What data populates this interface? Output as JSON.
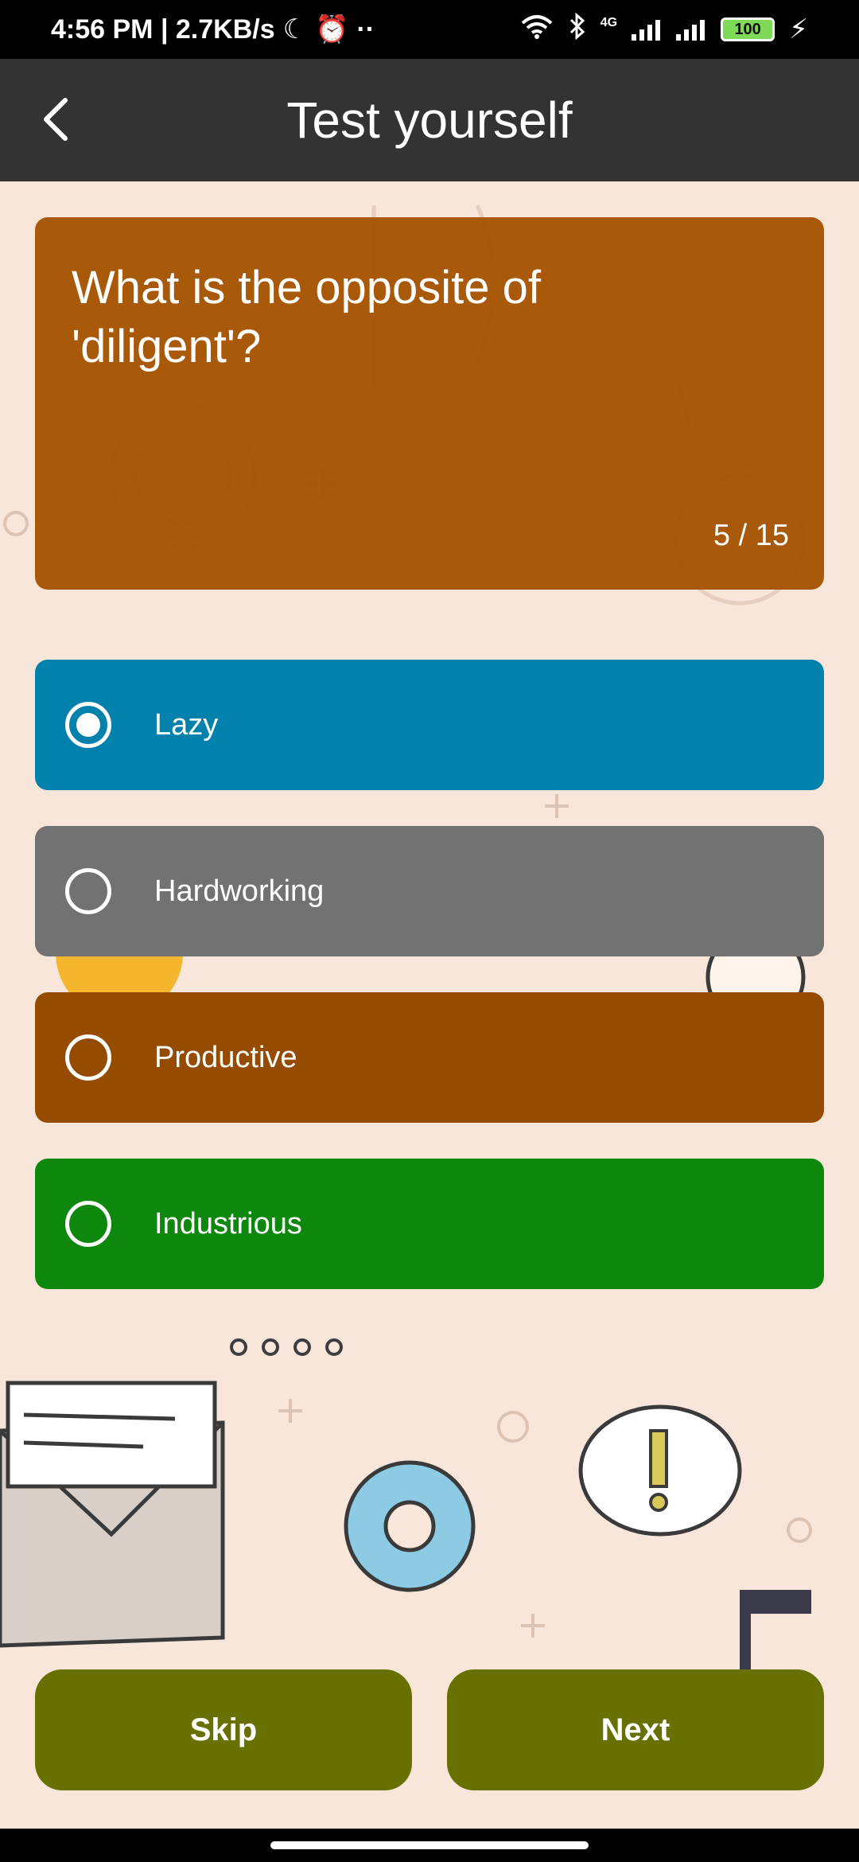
{
  "status_bar": {
    "time": "4:56 PM | 2.7KB/s",
    "network": "4G",
    "battery": "100"
  },
  "app_bar": {
    "title": "Test yourself",
    "back_icon": "back-arrow-icon"
  },
  "question": {
    "text": "What is the opposite of 'diligent'?",
    "counter": "5 / 15"
  },
  "options": [
    {
      "label": "Lazy",
      "selected": true,
      "color": "#0281ac"
    },
    {
      "label": "Hardworking",
      "selected": false,
      "color": "#727272"
    },
    {
      "label": "Productive",
      "selected": false,
      "color": "#964c00"
    },
    {
      "label": "Industrious",
      "selected": false,
      "color": "#0d870c"
    }
  ],
  "buttons": {
    "skip": "Skip",
    "next": "Next"
  },
  "colors": {
    "app_bar": "#333333",
    "question_card": "#a65403",
    "button": "#677000",
    "background": "#f8e6da"
  }
}
